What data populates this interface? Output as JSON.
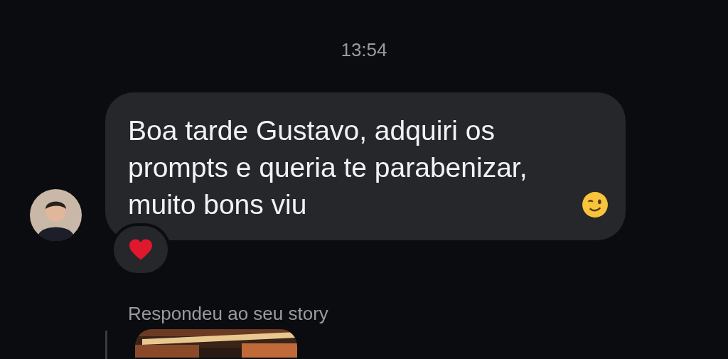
{
  "timestamp": "13:54",
  "message": {
    "text": "Boa tarde Gustavo, adquiri os prompts e queria te parabenizar, muito bons viu",
    "reaction": {
      "kind": "heart"
    }
  },
  "story_reply": {
    "label": "Respondeu ao seu story"
  }
}
